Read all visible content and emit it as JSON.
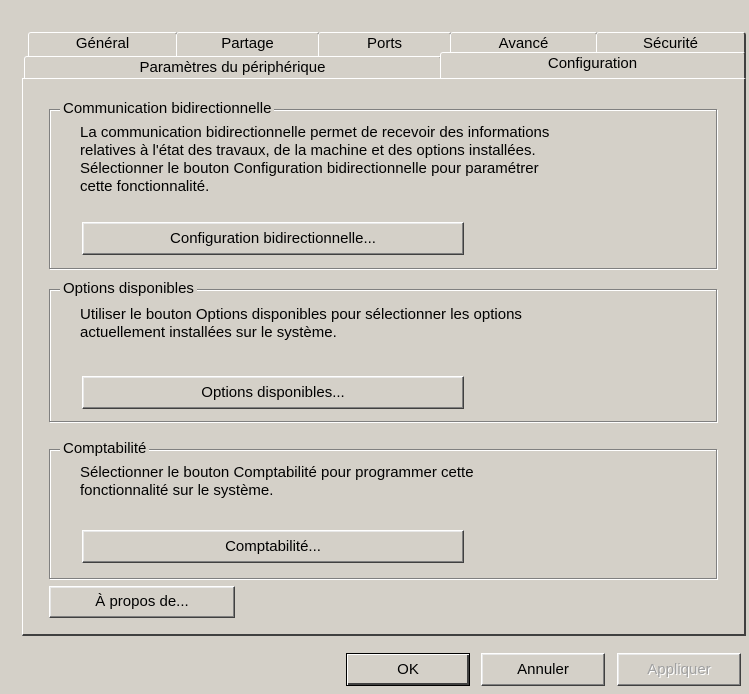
{
  "tabs_row1": [
    "Général",
    "Partage",
    "Ports",
    "Avancé",
    "Sécurité"
  ],
  "tabs_row2": [
    "Paramètres du périphérique",
    "Configuration"
  ],
  "active_tab": "Configuration",
  "bidir": {
    "legend": "Communication bidirectionnelle",
    "description": "La communication bidirectionnelle permet de recevoir des informations\nrelatives à l'état des travaux, de la machine et des options installées.\nSélectionner le bouton Configuration bidirectionnelle pour paramétrer\ncette fonctionnalité.",
    "button": "Configuration bidirectionnelle..."
  },
  "options": {
    "legend": "Options disponibles",
    "description": "Utiliser le bouton Options disponibles pour sélectionner les options\nactuellement installées sur le système.",
    "button": "Options disponibles..."
  },
  "accounting": {
    "legend": "Comptabilité",
    "description": "Sélectionner le bouton Comptabilité pour programmer cette\nfonctionnalité sur le système.",
    "button": "Comptabilité..."
  },
  "about_button": "À propos de...",
  "dialog_buttons": {
    "ok": "OK",
    "cancel": "Annuler",
    "apply": "Appliquer"
  }
}
